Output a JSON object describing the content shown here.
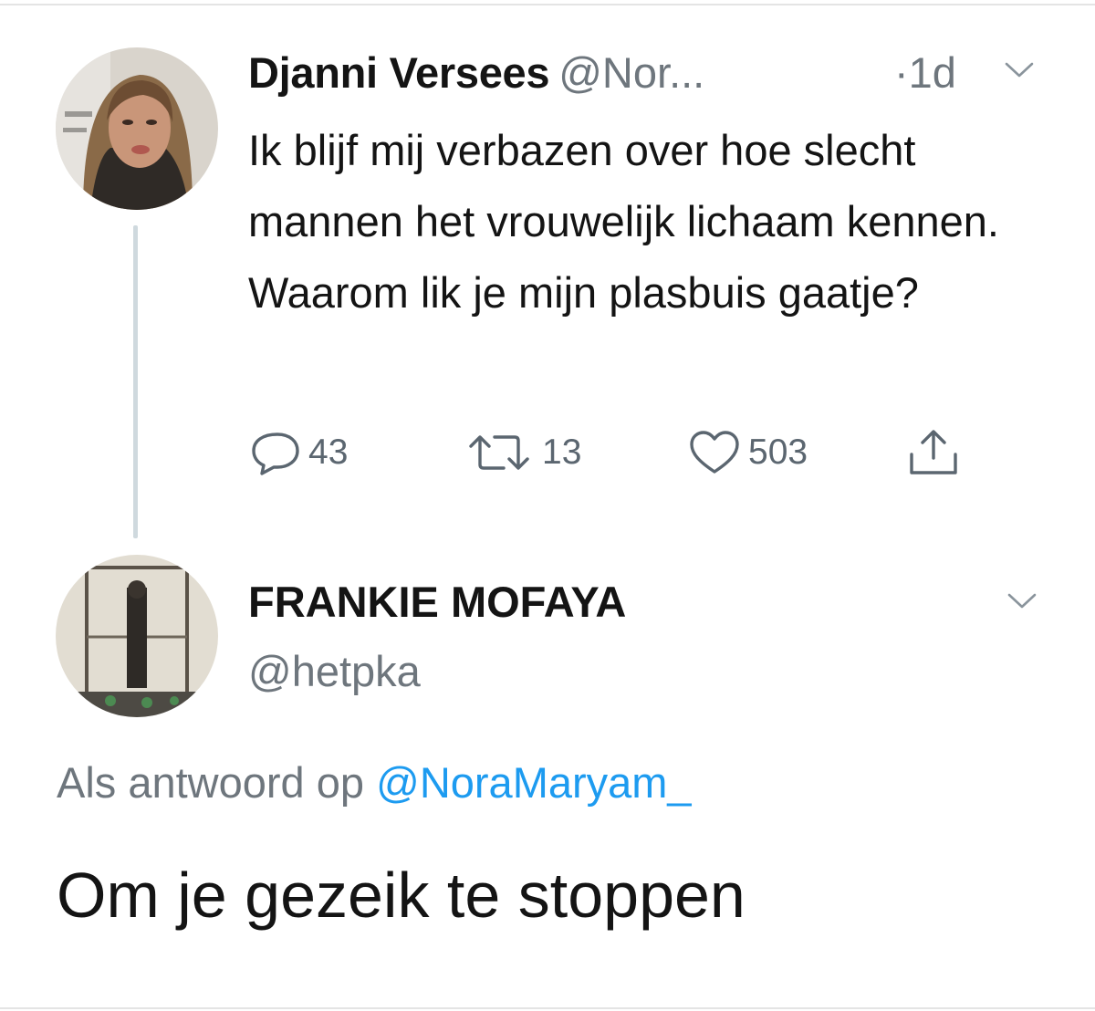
{
  "colors": {
    "text": "#141414",
    "secondary": "#6e767d",
    "link": "#1d9bf0",
    "thread_line": "#cfd9de"
  },
  "tweet": {
    "display_name": "Djanni Versees",
    "handle": "@Nor...",
    "time": "·1d",
    "text": "Ik blijf mij verbazen over hoe slecht mannen het vrouwelijk lichaam kennen. Waarom lik je mijn plasbuis gaatje?",
    "replies": "43",
    "retweets": "13",
    "likes": "503",
    "icons": [
      "reply-icon",
      "retweet-icon",
      "like-icon",
      "share-icon",
      "chevron-down-icon"
    ]
  },
  "reply": {
    "display_name": "FRANKIE MOFAYA",
    "handle": "@hetpka",
    "reply_prefix": "Als antwoord op",
    "reply_mention": "@NoraMaryam_",
    "text": "Om je gezeik te stoppen"
  }
}
